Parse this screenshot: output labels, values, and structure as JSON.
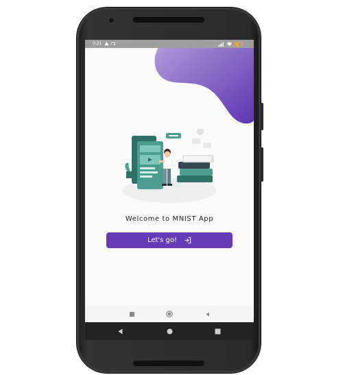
{
  "status_bar": {
    "time": "0:21",
    "left_icons": [
      "warning-icon",
      "cast-icon"
    ],
    "right_icons": [
      "signal-icon",
      "wifi-icon",
      "battery-icon"
    ]
  },
  "welcome": {
    "text": "Welcome to MNIST App"
  },
  "cta": {
    "label": "Let's go!",
    "icon": "login-icon"
  },
  "app_nav": {
    "items": [
      "square-nav-icon",
      "circle-nav-icon",
      "back-triangle-icon"
    ]
  },
  "system_nav": {
    "items": [
      "back-icon",
      "home-icon",
      "recents-icon"
    ]
  },
  "colors": {
    "accent": "#673ab7",
    "blob_top": "#9575cd",
    "blob_bottom": "#5e35b1",
    "teal": "#4a9d8f",
    "teal_dark": "#2f6f66",
    "status_bar": "#9e9e9e",
    "battery": "#f9a825"
  }
}
